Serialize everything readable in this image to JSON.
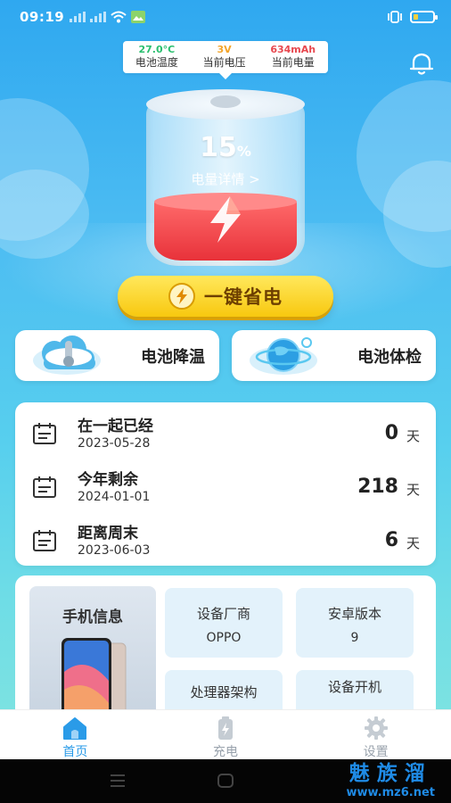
{
  "status_bar": {
    "time": "09:19"
  },
  "battery_info": {
    "temperature": {
      "value": "27.0°C",
      "label": "电池温度",
      "color": "#2bbf6f"
    },
    "voltage": {
      "value": "3V",
      "label": "当前电压",
      "color": "#f4a52b"
    },
    "capacity": {
      "value": "634mAh",
      "label": "当前电量",
      "color": "#e8484f"
    }
  },
  "battery": {
    "percent": "15",
    "percent_sign": "%",
    "details_link": "电量详情 >",
    "level": 0.15
  },
  "one_key_save": {
    "label": "一键省电"
  },
  "features": [
    {
      "label": "电池降温"
    },
    {
      "label": "电池体检"
    }
  ],
  "dates": [
    {
      "title": "在一起已经",
      "date": "2023-05-28",
      "value": "0",
      "unit": "天"
    },
    {
      "title": "今年剩余",
      "date": "2024-01-01",
      "value": "218",
      "unit": "天"
    },
    {
      "title": "距离周末",
      "date": "2023-06-03",
      "value": "6",
      "unit": "天"
    }
  ],
  "phone_info": {
    "title": "手机信息",
    "specs": [
      {
        "key": "设备厂商",
        "value": "OPPO"
      },
      {
        "key": "安卓版本",
        "value": "9"
      },
      {
        "key": "处理器架构",
        "value": ""
      },
      {
        "key": "设备开机",
        "value": ""
      }
    ]
  },
  "bottom_nav": [
    {
      "label": "首页",
      "active": true
    },
    {
      "label": "充电",
      "active": false
    },
    {
      "label": "设置",
      "active": false
    }
  ],
  "watermark": {
    "big": "魅族溜",
    "small": "www.mz6.net"
  },
  "colors": {
    "accent": "#2a9be8",
    "button_yellow": "#f8c80f",
    "battery_red": "#e8323a"
  }
}
